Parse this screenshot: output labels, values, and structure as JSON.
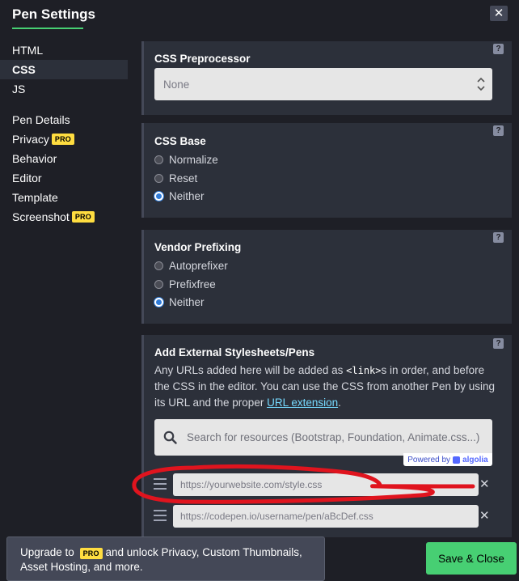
{
  "header": {
    "title": "Pen Settings",
    "close_label": "✕"
  },
  "sidebar": {
    "group1": [
      {
        "label": "HTML"
      },
      {
        "label": "CSS"
      },
      {
        "label": "JS"
      }
    ],
    "group2": [
      {
        "label": "Pen Details"
      },
      {
        "label": "Privacy",
        "badge": "PRO"
      },
      {
        "label": "Behavior"
      },
      {
        "label": "Editor"
      },
      {
        "label": "Template"
      },
      {
        "label": "Screenshot",
        "badge": "PRO"
      }
    ]
  },
  "preprocessor": {
    "title": "CSS Preprocessor",
    "value": "None",
    "help": "?"
  },
  "base": {
    "title": "CSS Base",
    "help": "?",
    "options": [
      {
        "label": "Normalize"
      },
      {
        "label": "Reset"
      },
      {
        "label": "Neither",
        "selected": true
      }
    ]
  },
  "prefix": {
    "title": "Vendor Prefixing",
    "help": "?",
    "options": [
      {
        "label": "Autoprefixer"
      },
      {
        "label": "Prefixfree"
      },
      {
        "label": "Neither",
        "selected": true
      }
    ]
  },
  "external": {
    "title": "Add External Stylesheets/Pens",
    "help": "?",
    "desc_1": "Any URLs added here will be added as ",
    "desc_code": "<link>",
    "desc_2": "s in order, and before the CSS in the editor. You can use the CSS from another Pen by using its URL and the proper ",
    "desc_link": "URL extension",
    "desc_3": ".",
    "search_placeholder": "Search for resources (Bootstrap, Foundation, Animate.css...)",
    "powered_by": "Powered by",
    "powered_brand": "algolia",
    "resources": [
      {
        "placeholder": "https://yourwebsite.com/style.css"
      },
      {
        "placeholder": "https://codepen.io/username/pen/aBcDef.css"
      }
    ]
  },
  "footer": {
    "upgrade_1": "Upgrade to",
    "upgrade_badge": "PRO",
    "upgrade_2": "and unlock Privacy, Custom Thumbnails, Asset Hosting, and more.",
    "save_label": "Save & Close"
  },
  "colors": {
    "accent_green": "#47cf73",
    "pro_yellow": "#ffdd40",
    "annotation_red": "#e0141e",
    "link_blue": "#76daff"
  }
}
